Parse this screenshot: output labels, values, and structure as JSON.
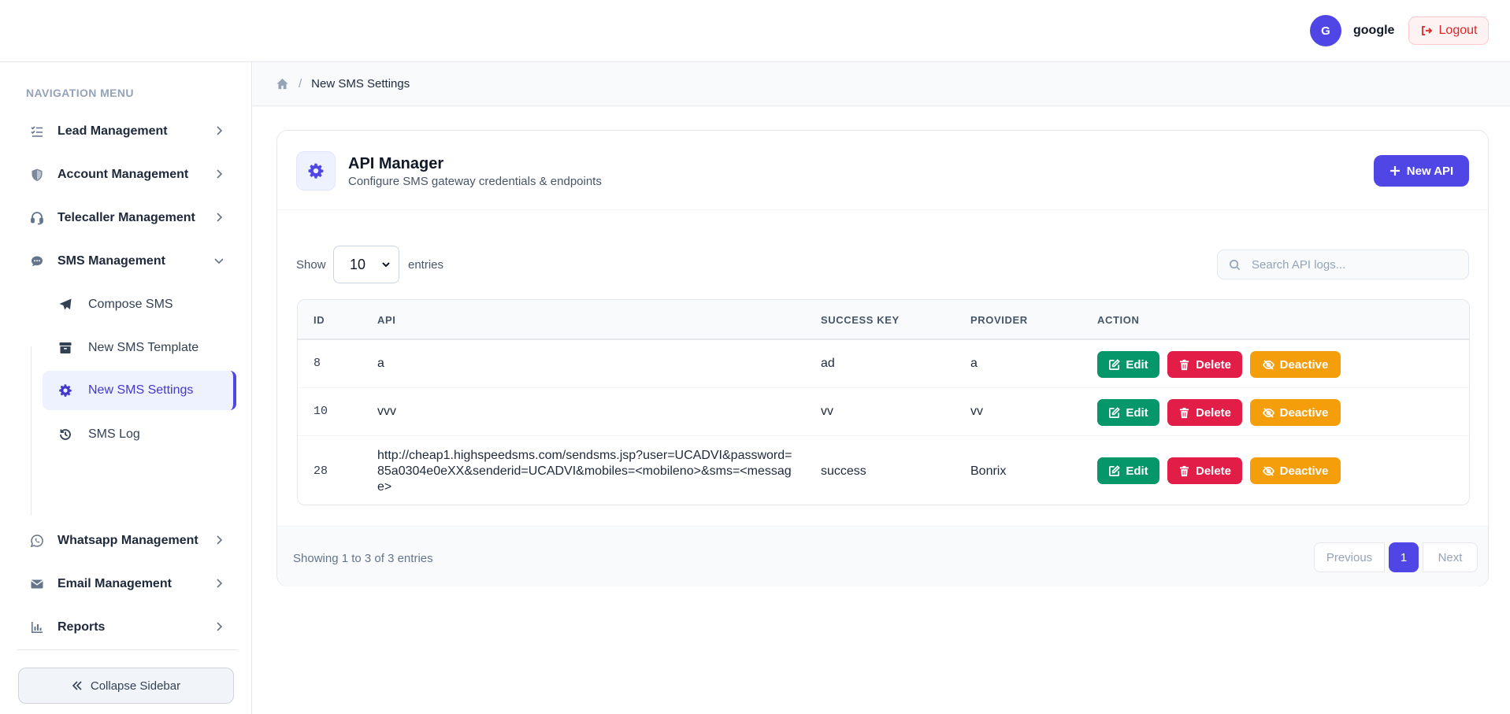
{
  "header": {
    "avatar_initial": "G",
    "username": "google",
    "logout_label": "Logout"
  },
  "sidebar": {
    "title": "NAVIGATION MENU",
    "items": [
      {
        "label": "Lead Management",
        "icon": "list-check-icon"
      },
      {
        "label": "Account Management",
        "icon": "shield-icon"
      },
      {
        "label": "Telecaller Management",
        "icon": "headset-icon"
      },
      {
        "label": "SMS Management",
        "icon": "chat-bubble-icon",
        "expanded": true
      },
      {
        "label": "Whatsapp Management",
        "icon": "whatsapp-icon"
      },
      {
        "label": "Email Management",
        "icon": "envelope-icon"
      },
      {
        "label": "Reports",
        "icon": "bar-chart-icon"
      }
    ],
    "sms_submenu": [
      {
        "label": "Compose SMS",
        "icon": "paper-plane-icon"
      },
      {
        "label": "New SMS Template",
        "icon": "archive-box-icon"
      },
      {
        "label": "New SMS Settings",
        "icon": "gear-icon",
        "active": true
      },
      {
        "label": "SMS Log",
        "icon": "history-icon"
      }
    ],
    "collapse_label": "Collapse Sidebar"
  },
  "breadcrumb": {
    "home_icon": "home-icon",
    "current": "New SMS Settings"
  },
  "card": {
    "title": "API Manager",
    "subtitle": "Configure SMS gateway credentials & endpoints",
    "new_button_label": "New API",
    "show_label": "Show",
    "entries_value": "10",
    "entries_label": "entries",
    "search_placeholder": "Search API logs..."
  },
  "table": {
    "columns": [
      "ID",
      "API",
      "SUCCESS KEY",
      "PROVIDER",
      "ACTION"
    ],
    "rows": [
      {
        "id": "8",
        "api": "a",
        "success_key": "ad",
        "provider": "a"
      },
      {
        "id": "10",
        "api": "vvv",
        "success_key": "vv",
        "provider": "vv"
      },
      {
        "id": "28",
        "api": "http://cheap1.highspeedsms.com/sendsms.jsp?user=UCADVI&password=85a0304e0eXX&senderid=UCADVI&mobiles=<mobileno>&sms=<message>",
        "success_key": "success",
        "provider": "Bonrix"
      }
    ],
    "actions": {
      "edit": "Edit",
      "delete": "Delete",
      "deactive": "Deactive"
    }
  },
  "footer": {
    "info": "Showing 1 to 3 of 3 entries",
    "previous": "Previous",
    "page": "1",
    "next": "Next"
  },
  "colors": {
    "accent": "#4f46e5",
    "edit": "#059669",
    "delete": "#e11d48",
    "deactive": "#f59e0b",
    "logout": "#dc2626"
  }
}
